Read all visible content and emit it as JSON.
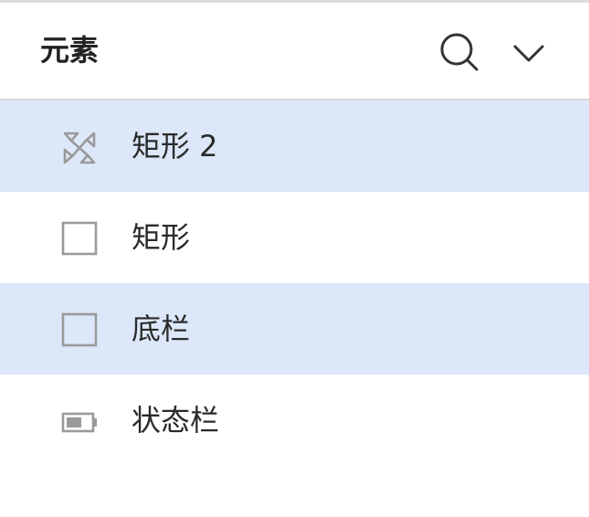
{
  "header": {
    "title": "元素",
    "search_icon": "search-icon",
    "collapse_icon": "chevron-down-icon"
  },
  "layers": [
    {
      "label": "矩形 2",
      "icon": "mask-pinwheel-icon",
      "selected": true
    },
    {
      "label": "矩形",
      "icon": "rectangle-icon",
      "selected": false
    },
    {
      "label": "底栏",
      "icon": "rectangle-icon",
      "selected": true
    },
    {
      "label": "状态栏",
      "icon": "battery-icon",
      "selected": false
    }
  ],
  "colors": {
    "selected_row": "#dce8f9",
    "icon_gray": "#9a9a9a",
    "text": "#2a2a2a"
  }
}
